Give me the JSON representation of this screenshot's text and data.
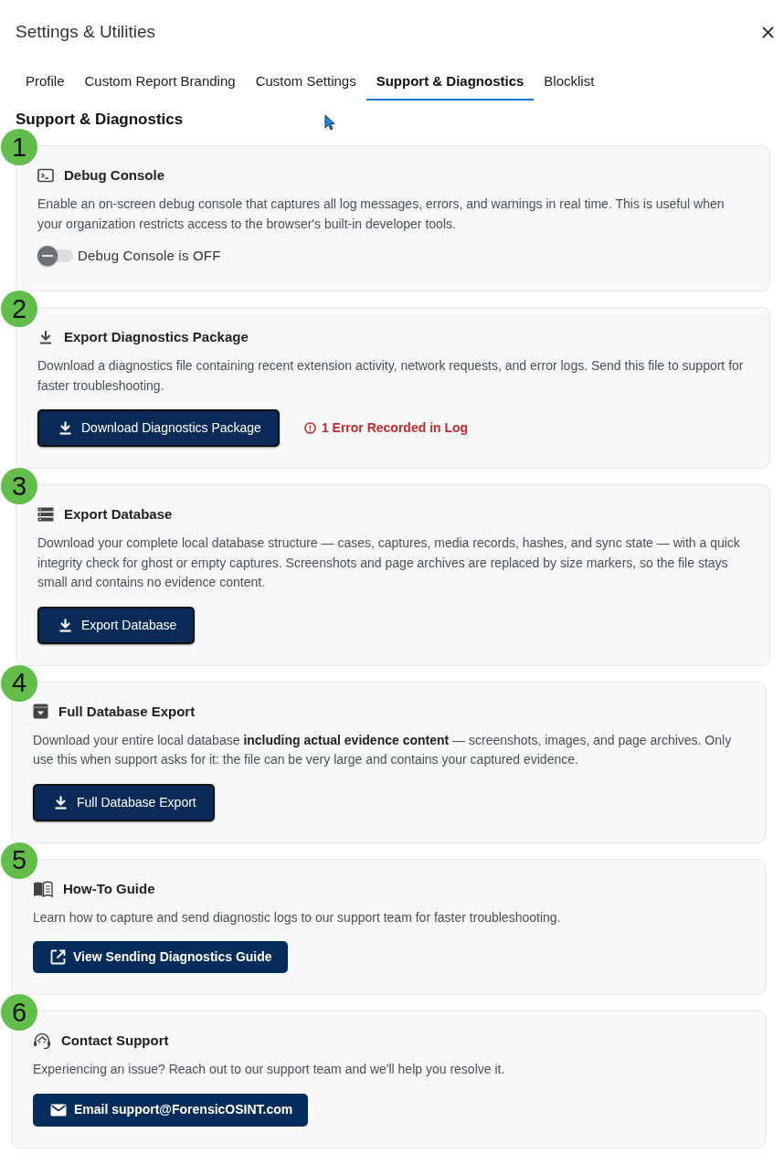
{
  "window": {
    "title": "Settings & Utilities"
  },
  "tabs": [
    {
      "label": "Profile",
      "selected": false
    },
    {
      "label": "Custom Report Branding",
      "selected": false
    },
    {
      "label": "Custom Settings",
      "selected": false
    },
    {
      "label": "Support & Diagnostics",
      "selected": true
    },
    {
      "label": "Blocklist",
      "selected": false
    }
  ],
  "page_heading": "Support & Diagnostics",
  "sections": [
    {
      "kind": "console",
      "step": "1",
      "title": "Debug Console",
      "description": "Enable an on-screen debug console that captures all log messages, errors, and warnings in real time. This is useful when your organization restricts access to the browser's built-in developer tools.",
      "toggle": {
        "label": "Debug Console is OFF",
        "on": false
      }
    },
    {
      "kind": "diagnostics",
      "step": "2",
      "title": "Export Diagnostics Package",
      "description": "Download a diagnostics file containing recent extension activity, network requests, and error logs. Send this file to support for faster troubleshooting.",
      "button": {
        "kind": "download",
        "label": "Download Diagnostics Package"
      },
      "error": "1 Error Recorded in Log"
    },
    {
      "kind": "database",
      "step": "3",
      "title": "Export Database",
      "description": "Download your complete local database structure — cases, captures, media records, hashes, and sync state — with a quick integrity check for ghost or empty captures. Screenshots and page archives are replaced by size markers, so the file stays small and contains no evidence content.",
      "button": {
        "kind": "download",
        "label": "Export Database"
      }
    },
    {
      "kind": "archive",
      "step": "4",
      "title": "Full Database Export",
      "description": "Download your entire local database **including actual evidence content** — screenshots, images, and page archives. Only use this when support asks for it: the file can be very large and contains your captured evidence.",
      "button": {
        "kind": "download",
        "label": "Full Database Export"
      }
    },
    {
      "kind": "guide",
      "step": "5",
      "title": "How-To Guide",
      "description": "Learn how to capture and send diagnostic logs to our support team for faster troubleshooting.",
      "button": {
        "kind": "guide",
        "label": "View Sending Diagnostics Guide"
      }
    },
    {
      "kind": "support",
      "step": "6",
      "title": "Contact Support",
      "description": "Experiencing an issue? Reach out to our support team and we'll help you resolve it.",
      "button": {
        "kind": "email",
        "label": "Email support@ForensicOSINT.com"
      }
    }
  ]
}
